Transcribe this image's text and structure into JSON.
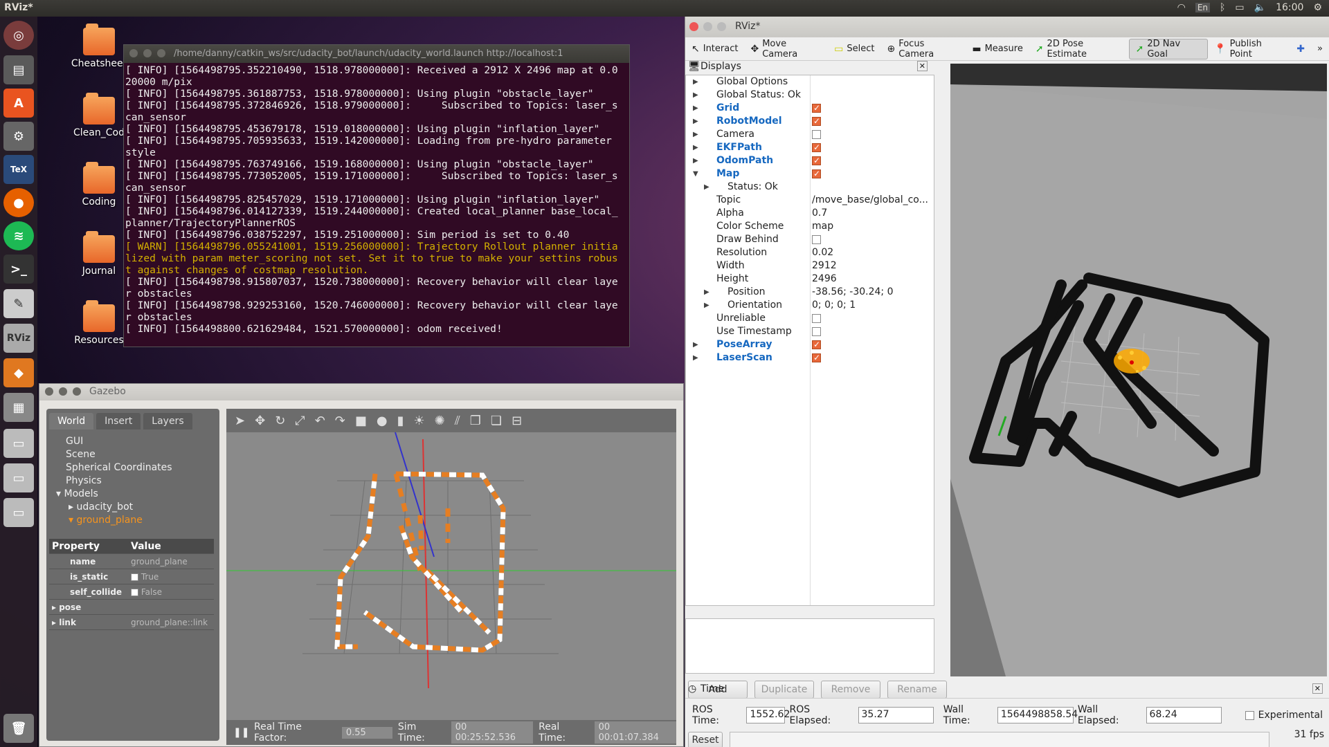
{
  "topbar": {
    "title": "RViz*",
    "keyboard": "En",
    "time": "16:00"
  },
  "desktop": {
    "icons": [
      {
        "label": "Cheatsheet"
      },
      {
        "label": "Clean_Cod"
      },
      {
        "label": "Coding"
      },
      {
        "label": "Journal"
      },
      {
        "label": "Resources"
      }
    ]
  },
  "terminal": {
    "title": "/home/danny/catkin_ws/src/udacity_bot/launch/udacity_world.launch http://localhost:1",
    "lines": [
      {
        "cls": "",
        "text": "[ INFO] [1564498795.352210490, 1518.978000000]: Received a 2912 X 2496 map at 0.020000 m/pix"
      },
      {
        "cls": "",
        "text": "[ INFO] [1564498795.361887753, 1518.978000000]: Using plugin \"obstacle_layer\""
      },
      {
        "cls": "",
        "text": "[ INFO] [1564498795.372846926, 1518.979000000]:     Subscribed to Topics: laser_scan_sensor"
      },
      {
        "cls": "",
        "text": "[ INFO] [1564498795.453679178, 1519.018000000]: Using plugin \"inflation_layer\""
      },
      {
        "cls": "",
        "text": "[ INFO] [1564498795.705935633, 1519.142000000]: Loading from pre-hydro parameter style"
      },
      {
        "cls": "",
        "text": "[ INFO] [1564498795.763749166, 1519.168000000]: Using plugin \"obstacle_layer\""
      },
      {
        "cls": "",
        "text": "[ INFO] [1564498795.773052005, 1519.171000000]:     Subscribed to Topics: laser_scan_sensor"
      },
      {
        "cls": "",
        "text": "[ INFO] [1564498795.825457029, 1519.171000000]: Using plugin \"inflation_layer\""
      },
      {
        "cls": "",
        "text": "[ INFO] [1564498796.014127339, 1519.244000000]: Created local_planner base_local_planner/TrajectoryPlannerROS"
      },
      {
        "cls": "",
        "text": "[ INFO] [1564498796.038752297, 1519.251000000]: Sim period is set to 0.40"
      },
      {
        "cls": "warn",
        "text": "[ WARN] [1564498796.055241001, 1519.256000000]: Trajectory Rollout planner initialized with param meter_scoring not set. Set it to true to make your settins robust against changes of costmap resolution."
      },
      {
        "cls": "",
        "text": "[ INFO] [1564498798.915807037, 1520.738000000]: Recovery behavior will clear layer obstacles"
      },
      {
        "cls": "",
        "text": "[ INFO] [1564498798.929253160, 1520.746000000]: Recovery behavior will clear layer obstacles"
      },
      {
        "cls": "",
        "text": "[ INFO] [1564498800.621629484, 1521.570000000]: odom received!"
      }
    ]
  },
  "gazebo": {
    "title": "Gazebo",
    "tabs": [
      "World",
      "Insert",
      "Layers"
    ],
    "tree": [
      "GUI",
      "Scene",
      "Spherical Coordinates",
      "Physics",
      "Models",
      "udacity_bot",
      "ground_plane"
    ],
    "prop_header": {
      "k": "Property",
      "v": "Value"
    },
    "props": [
      {
        "k": "name",
        "v": "ground_plane"
      },
      {
        "k": "is_static",
        "v": "True"
      },
      {
        "k": "self_collide",
        "v": "False"
      },
      {
        "k": "pose",
        "v": ""
      },
      {
        "k": "link",
        "v": "ground_plane::link"
      }
    ],
    "status": {
      "rtf_label": "Real Time Factor:",
      "rtf": "0.55",
      "sim_label": "Sim Time:",
      "sim": "00 00:25:52.536",
      "real_label": "Real Time:",
      "real": "00 00:01:07.384"
    }
  },
  "rviz": {
    "title": "RViz*",
    "tools": [
      {
        "icon": "interact-icon",
        "label": "Interact"
      },
      {
        "icon": "move-camera-icon",
        "label": "Move Camera"
      },
      {
        "icon": "select-icon",
        "label": "Select"
      },
      {
        "icon": "focus-camera-icon",
        "label": "Focus Camera"
      },
      {
        "icon": "measure-icon",
        "label": "Measure"
      },
      {
        "icon": "pose-estimate-icon",
        "label": "2D Pose Estimate"
      },
      {
        "icon": "nav-goal-icon",
        "label": "2D Nav Goal"
      },
      {
        "icon": "publish-point-icon",
        "label": "Publish Point"
      }
    ],
    "displays_title": "Displays",
    "displays": [
      {
        "arrow": "▶",
        "name": "Global Options",
        "blue": false,
        "val": "",
        "check": null,
        "indent": 0
      },
      {
        "arrow": "▶",
        "name": "Global Status: Ok",
        "blue": false,
        "val": "",
        "check": null,
        "indent": 0
      },
      {
        "arrow": "▶",
        "name": "Grid",
        "blue": true,
        "val": "",
        "check": true,
        "indent": 0
      },
      {
        "arrow": "▶",
        "name": "RobotModel",
        "blue": true,
        "val": "",
        "check": true,
        "indent": 0
      },
      {
        "arrow": "▶",
        "name": "Camera",
        "blue": false,
        "val": "",
        "check": false,
        "indent": 0
      },
      {
        "arrow": "▶",
        "name": "EKFPath",
        "blue": true,
        "val": "",
        "check": true,
        "indent": 0
      },
      {
        "arrow": "▶",
        "name": "OdomPath",
        "blue": true,
        "val": "",
        "check": true,
        "indent": 0
      },
      {
        "arrow": "▼",
        "name": "Map",
        "blue": true,
        "val": "",
        "check": true,
        "indent": 0
      },
      {
        "arrow": "▶",
        "name": "Status: Ok",
        "blue": false,
        "val": "",
        "check": null,
        "indent": 1
      },
      {
        "arrow": "",
        "name": "Topic",
        "blue": false,
        "val": "/move_base/global_co...",
        "check": null,
        "indent": 1
      },
      {
        "arrow": "",
        "name": "Alpha",
        "blue": false,
        "val": "0.7",
        "check": null,
        "indent": 1
      },
      {
        "arrow": "",
        "name": "Color Scheme",
        "blue": false,
        "val": "map",
        "check": null,
        "indent": 1
      },
      {
        "arrow": "",
        "name": "Draw Behind",
        "blue": false,
        "val": "",
        "check": false,
        "indent": 1
      },
      {
        "arrow": "",
        "name": "Resolution",
        "blue": false,
        "val": "0.02",
        "check": null,
        "indent": 1
      },
      {
        "arrow": "",
        "name": "Width",
        "blue": false,
        "val": "2912",
        "check": null,
        "indent": 1
      },
      {
        "arrow": "",
        "name": "Height",
        "blue": false,
        "val": "2496",
        "check": null,
        "indent": 1
      },
      {
        "arrow": "▶",
        "name": "Position",
        "blue": false,
        "val": "-38.56; -30.24; 0",
        "check": null,
        "indent": 1
      },
      {
        "arrow": "▶",
        "name": "Orientation",
        "blue": false,
        "val": "0; 0; 0; 1",
        "check": null,
        "indent": 1
      },
      {
        "arrow": "",
        "name": "Unreliable",
        "blue": false,
        "val": "",
        "check": false,
        "indent": 1
      },
      {
        "arrow": "",
        "name": "Use Timestamp",
        "blue": false,
        "val": "",
        "check": false,
        "indent": 1
      },
      {
        "arrow": "▶",
        "name": "PoseArray",
        "blue": true,
        "val": "",
        "check": true,
        "indent": 0
      },
      {
        "arrow": "▶",
        "name": "LaserScan",
        "blue": true,
        "val": "",
        "check": true,
        "indent": 0
      }
    ],
    "buttons": {
      "add": "Add",
      "duplicate": "Duplicate",
      "remove": "Remove",
      "rename": "Rename"
    },
    "time": {
      "title": "Time",
      "ros_time_label": "ROS Time:",
      "ros_time": "1552.62",
      "ros_elapsed_label": "ROS Elapsed:",
      "ros_elapsed": "35.27",
      "wall_time_label": "Wall Time:",
      "wall_time": "1564498858.54",
      "wall_elapsed_label": "Wall Elapsed:",
      "wall_elapsed": "68.24",
      "experimental": "Experimental",
      "reset": "Reset",
      "fps": "31 fps"
    }
  }
}
